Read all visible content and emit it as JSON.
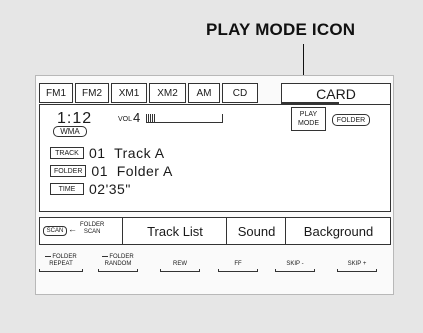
{
  "callout": {
    "label": "PLAY MODE ICON"
  },
  "tabs": [
    "FM1",
    "FM2",
    "XM1",
    "XM2",
    "AM",
    "CD"
  ],
  "active_tab": "CARD",
  "display": {
    "time": "1:12",
    "vol_label": "VOL",
    "vol_value": "4",
    "vol_level": 0.12,
    "format": "WMA",
    "play_mode": [
      "PLAY",
      "MODE"
    ],
    "folder_badge": "FOLDER",
    "track_label": "TRACK",
    "track_value": "01  Track A",
    "folder_label": "FOLDER",
    "folder_value": "01  Folder A",
    "time_label": "TIME",
    "time_value": "02'35\""
  },
  "bottom_bar": {
    "scan": "SCAN",
    "arrow": "←",
    "folder_scan": [
      "FOLDER",
      "SCAN"
    ],
    "menu": [
      "Track List",
      "Sound",
      "Background"
    ]
  },
  "softkeys": [
    {
      "lines": [
        "FOLDER",
        "REPEAT"
      ]
    },
    {
      "lines": [
        "FOLDER",
        "RANDOM"
      ]
    },
    {
      "lines": [
        "REW"
      ]
    },
    {
      "lines": [
        "FF"
      ]
    },
    {
      "lines": [
        "SKIP -"
      ]
    },
    {
      "lines": [
        "SKIP +"
      ]
    }
  ]
}
